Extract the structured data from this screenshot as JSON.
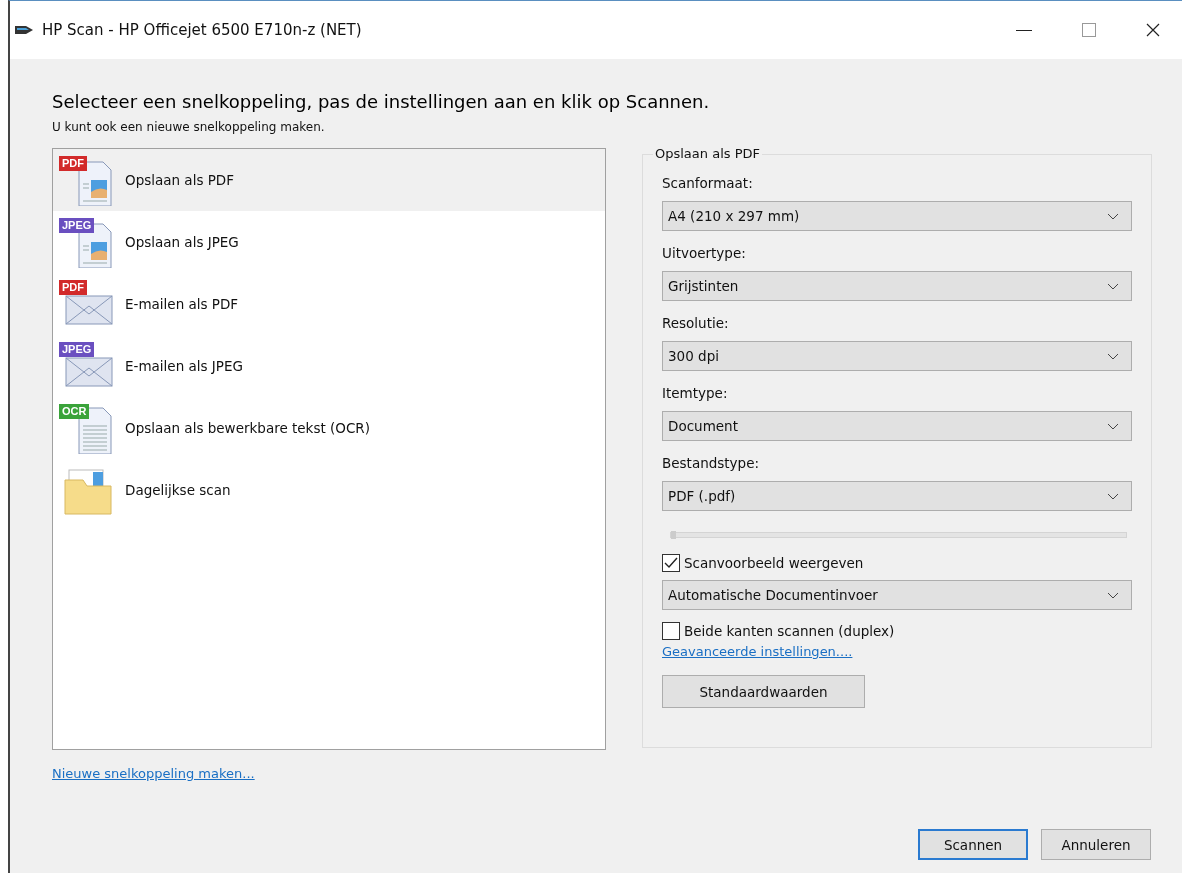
{
  "window": {
    "title": "HP Scan - HP Officejet 6500 E710n-z (NET)"
  },
  "heading": "Selecteer een snelkoppeling, pas de instellingen aan en klik op Scannen.",
  "subheading": "U kunt ook een nieuwe snelkoppeling maken.",
  "shortcuts": [
    {
      "label": "Opslaan als PDF",
      "kind": "photo-doc",
      "badge": "PDF",
      "color": "#d22a2a",
      "selected": true
    },
    {
      "label": "Opslaan als JPEG",
      "kind": "photo-doc",
      "badge": "JPEG",
      "color": "#6a4fc0",
      "selected": false
    },
    {
      "label": "E-mailen als PDF",
      "kind": "envelope",
      "badge": "PDF",
      "color": "#d22a2a",
      "selected": false
    },
    {
      "label": "E-mailen als JPEG",
      "kind": "envelope",
      "badge": "JPEG",
      "color": "#6a4fc0",
      "selected": false
    },
    {
      "label": "Opslaan als bewerkbare tekst (OCR)",
      "kind": "text-doc",
      "badge": "OCR",
      "color": "#3aa33a",
      "selected": false
    },
    {
      "label": "Dagelijkse scan",
      "kind": "folder",
      "selected": false
    }
  ],
  "new_shortcut_link": "Nieuwe snelkoppeling maken...",
  "settings": {
    "title": "Opslaan als PDF",
    "fields": [
      {
        "label": "Scanformaat:",
        "value": "A4 (210 x 297 mm)"
      },
      {
        "label": "Uitvoertype:",
        "value": "Grijstinten"
      },
      {
        "label": "Resolutie:",
        "value": "300 dpi"
      },
      {
        "label": "Itemtype:",
        "value": "Document"
      },
      {
        "label": "Bestandstype:",
        "value": "PDF (.pdf)"
      }
    ],
    "quality_slider": {
      "level": 0
    },
    "preview": {
      "label": "Scanvoorbeeld weergeven",
      "checked": true
    },
    "source": {
      "value": "Automatische Documentinvoer"
    },
    "duplex": {
      "label": "Beide kanten scannen (duplex)",
      "checked": false
    },
    "advanced_link": "Geavanceerde instellingen....",
    "defaults_button": "Standaardwaarden"
  },
  "buttons": [
    {
      "label": "Scannen",
      "kind": "primary"
    },
    {
      "label": "Annuleren",
      "kind": "normal"
    }
  ]
}
